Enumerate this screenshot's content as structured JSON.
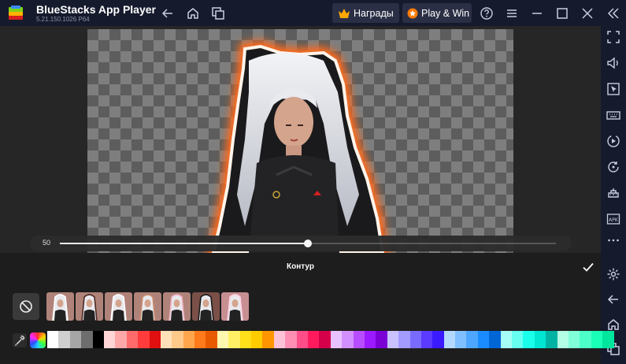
{
  "titlebar": {
    "app_name": "BlueStacks App Player",
    "version": "5.21.150.1026  P64",
    "rewards_label": "Награды",
    "playwin_label": "Play & Win",
    "icons": [
      "back-arrow-icon",
      "home-icon",
      "multi-instance-icon",
      "crown-icon",
      "play-win-icon",
      "help-icon",
      "menu-icon",
      "minimize-icon",
      "maximize-icon",
      "close-icon",
      "collapse-sidebar-icon"
    ]
  },
  "sidebar": {
    "icons": [
      "fullscreen-icon",
      "volume-icon",
      "cursor-icon",
      "keyboard-icon",
      "macro-play-icon",
      "rotate-icon",
      "gamepad-icon",
      "apk-install-icon",
      "more-icon",
      "settings-icon",
      "back-icon",
      "home-icon",
      "recent-apps-icon"
    ]
  },
  "editor": {
    "slider_value": "50",
    "slider_fraction": 0.5,
    "panel_title": "Контур",
    "outline_styles": [
      "none",
      "dark",
      "white",
      "brown",
      "pink",
      "black",
      "pink-light",
      "white-glow"
    ],
    "palette": [
      "#ffffff",
      "#cfcfcf",
      "#a6a6a6",
      "#6e6e6e",
      "#000000",
      "#ffd5d5",
      "#ffa8a8",
      "#ff6b6b",
      "#ff3b3b",
      "#e01010",
      "#ffe0b8",
      "#ffc98a",
      "#ffa64d",
      "#ff7a1a",
      "#e85a00",
      "#fff7b0",
      "#fff066",
      "#ffe01a",
      "#ffcc00",
      "#ff9500",
      "#ffc2d6",
      "#ff8fb3",
      "#ff4d88",
      "#ff1a5e",
      "#d6004a",
      "#e8c2ff",
      "#d28fff",
      "#b84dff",
      "#9b1aff",
      "#7a00d6",
      "#c9c2ff",
      "#a39bff",
      "#7a6bff",
      "#5a3bff",
      "#3a1aff",
      "#b3d9ff",
      "#80bfff",
      "#4da6ff",
      "#1a8cff",
      "#0066d6",
      "#a6fff7",
      "#66fff0",
      "#1affea",
      "#00e6d2",
      "#00b3a3",
      "#b3ffe6",
      "#80ffd9",
      "#4dffc9",
      "#1affb8",
      "#00e69c"
    ],
    "colors": {
      "outline_glow": "#ff7a1a",
      "titlebar_bg": "#161a2d",
      "panel_bg": "#1d1d1d",
      "accent": "#ffa800"
    }
  }
}
